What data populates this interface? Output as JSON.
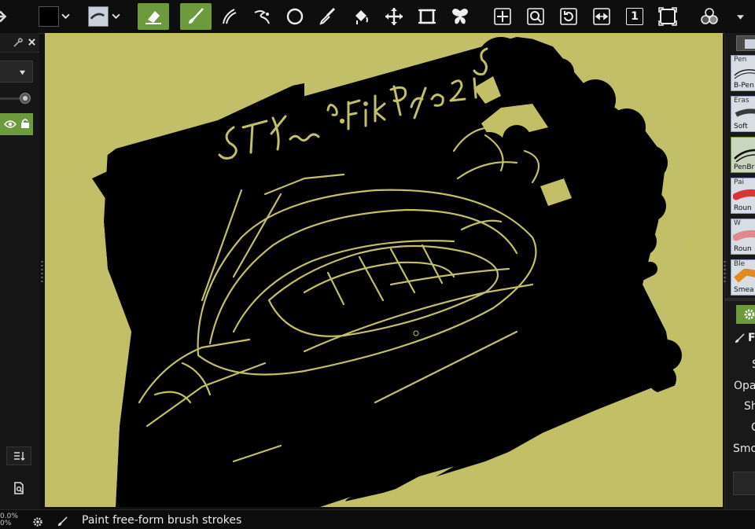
{
  "toolbar": {
    "color_swatch": "#000000",
    "accent": "#6e9a3e",
    "tools": [
      "color-swatch",
      "brush-preset",
      "eraser-mode",
      "paint-brush",
      "smudge",
      "smooth-stroke",
      "ellipse",
      "color-picker",
      "fill",
      "move-layer",
      "frame",
      "symmetry",
      "pan",
      "zoom",
      "rotate",
      "mirror",
      "reset-zoom",
      "fit-view",
      "workspace"
    ],
    "reset_zoom_label": "1"
  },
  "left_panel": {
    "layer_visible": true,
    "layer_locked": true
  },
  "canvas": {
    "paper_color": "#c2bf67",
    "ink_color": "#000000",
    "sketch_text": "ST/~~ n·Fik P/ro 2 215"
  },
  "right_panel": {
    "brushes": [
      {
        "name": "Pen",
        "sub": "B-Pen"
      },
      {
        "name": "Eras",
        "sub": "Soft"
      },
      {
        "name": "",
        "sub": "PenBru"
      },
      {
        "name": "Pai",
        "sub": "Roun"
      },
      {
        "name": "W",
        "sub": "Roun"
      },
      {
        "name": "Ble",
        "sub": "Smea"
      }
    ],
    "settings_header": "F",
    "properties": [
      "S",
      "Opa",
      "Sh",
      "C",
      "Smo"
    ]
  },
  "statusbar": {
    "zoom_line1": "0.0%",
    "zoom_line2": "0%",
    "status_text": "Paint free-form brush strokes"
  }
}
